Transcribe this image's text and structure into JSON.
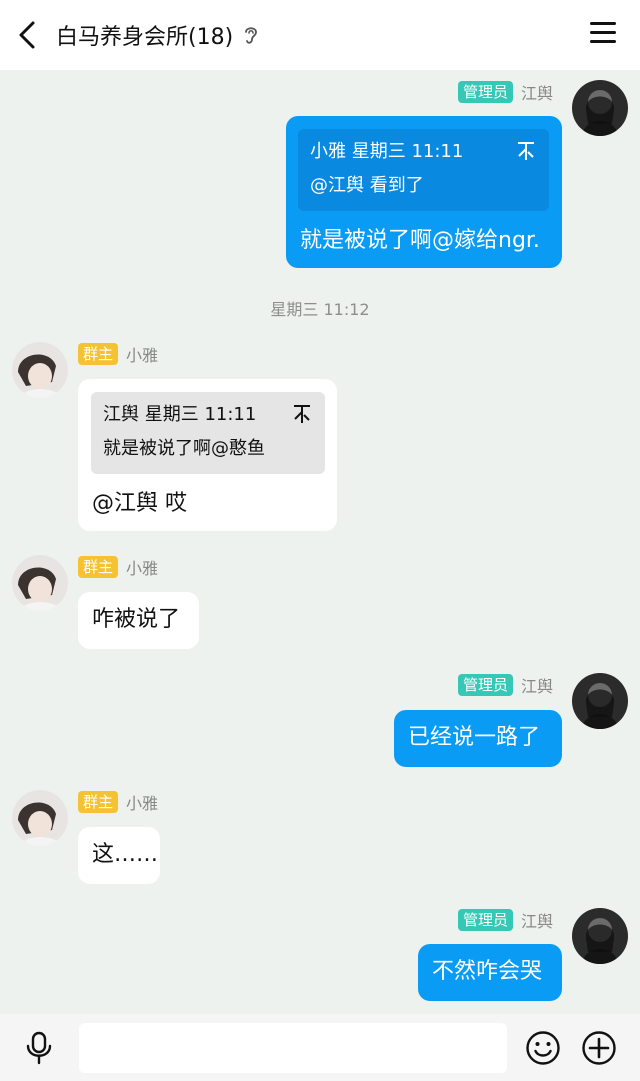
{
  "header": {
    "title": "白马养身会所(18)",
    "back_icon": "chevron-left-icon",
    "ear_icon": "ear-icon",
    "menu_icon": "hamburger-menu-icon"
  },
  "messages": [
    {
      "direction": "out",
      "badge": "管理员",
      "sender": "江舆",
      "quote": {
        "head": "小雅 星期三 11:11",
        "body": "@江舆 看到了"
      },
      "text": "就是被说了啊@嫁给ngr."
    },
    {
      "direction": "in",
      "badge": "群主",
      "sender": "小雅",
      "quote": {
        "head": "江舆 星期三 11:11",
        "body": "就是被说了啊@憨鱼"
      },
      "text": "@江舆 哎"
    },
    {
      "direction": "in",
      "badge": "群主",
      "sender": "小雅",
      "text": "咋被说了"
    },
    {
      "direction": "out",
      "badge": "管理员",
      "sender": "江舆",
      "text": "已经说一路了"
    },
    {
      "direction": "in",
      "badge": "群主",
      "sender": "小雅",
      "text": "这……"
    },
    {
      "direction": "out",
      "badge": "管理员",
      "sender": "江舆",
      "text": "不然咋会哭"
    }
  ],
  "timestamp": "星期三 11:12",
  "footer": {
    "input_placeholder": "",
    "mic_icon": "microphone-icon",
    "emoji_icon": "emoji-icon",
    "plus_icon": "plus-icon"
  },
  "colors": {
    "background": "#eef2ee",
    "outgoing_bubble": "#0a9bf5",
    "incoming_bubble": "#ffffff",
    "admin_badge": "#35c8b6",
    "owner_badge": "#f6c232"
  }
}
